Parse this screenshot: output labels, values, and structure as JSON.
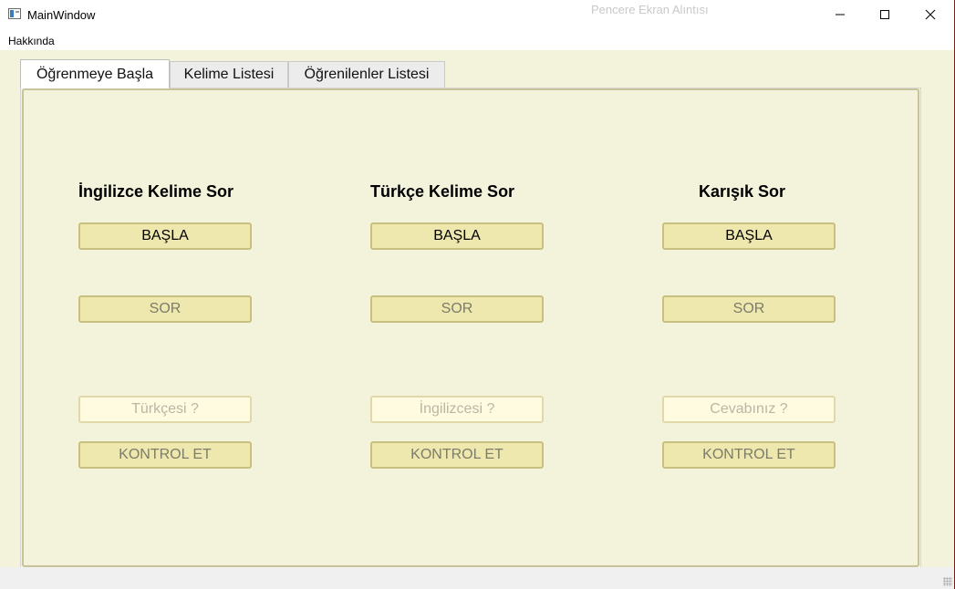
{
  "window": {
    "title": "MainWindow",
    "background_title": "Pencere Ekran Alıntısı",
    "controls": {
      "minimize_icon": "minimize-icon",
      "maximize_icon": "maximize-icon",
      "close_icon": "close-icon"
    }
  },
  "menubar": {
    "items": [
      {
        "label": "Hakkında"
      }
    ]
  },
  "tabs": [
    {
      "label": "Öğrenmeye Başla",
      "active": true
    },
    {
      "label": "Kelime Listesi",
      "active": false
    },
    {
      "label": "Öğrenilenler Listesi",
      "active": false
    }
  ],
  "columns": [
    {
      "title": "İngilizce Kelime Sor",
      "start_label": "BAŞLA",
      "ask_label": "SOR",
      "answer_placeholder": "Türkçesi ?",
      "check_label": "KONTROL ET"
    },
    {
      "title": "Türkçe Kelime Sor",
      "start_label": "BAŞLA",
      "ask_label": "SOR",
      "answer_placeholder": "İngilizcesi ?",
      "check_label": "KONTROL ET"
    },
    {
      "title": "Karışık Sor",
      "start_label": "BAŞLA",
      "ask_label": "SOR",
      "answer_placeholder": "Cevabınız ?",
      "check_label": "KONTROL ET"
    }
  ],
  "colors": {
    "pane_background": "#f3f3dc",
    "button_fill": "#eee8ae",
    "button_border": "#c8c080",
    "field_fill": "#fffbe0"
  }
}
